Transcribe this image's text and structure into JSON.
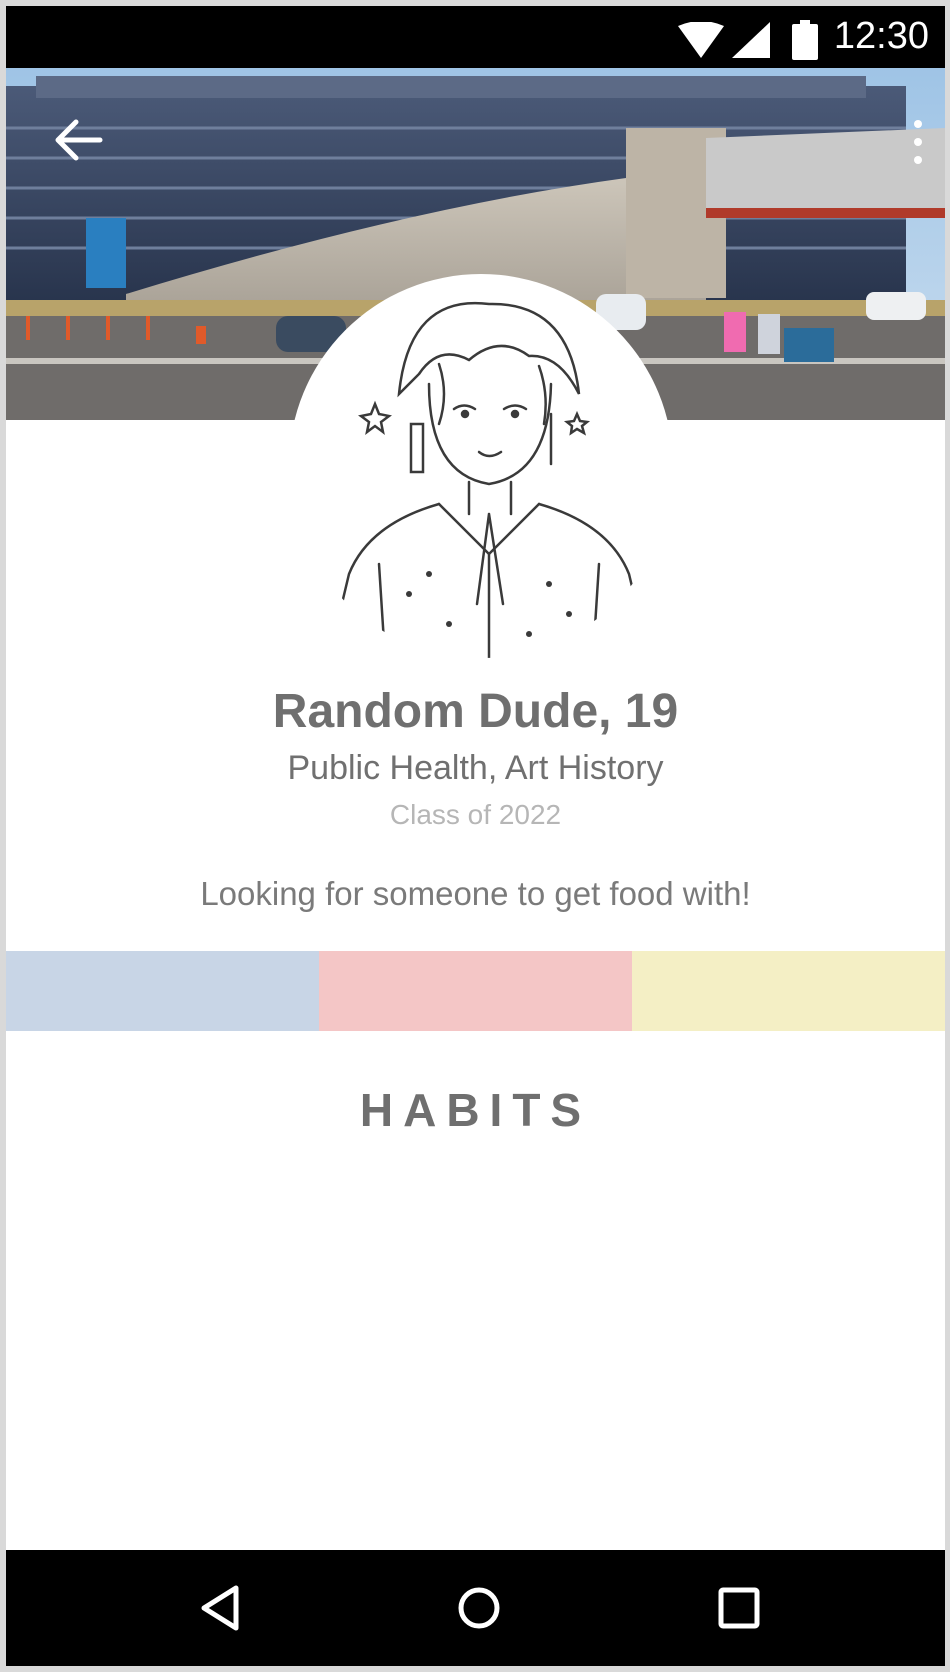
{
  "status_bar": {
    "time": "12:30",
    "icons": [
      "wifi-icon",
      "signal-icon",
      "battery-icon"
    ]
  },
  "header": {
    "back_icon": "arrow-left-icon",
    "menu_icon": "more-vertical-icon"
  },
  "profile": {
    "name_age": "Random Dude, 19",
    "majors": "Public Health, Art History",
    "class_year": "Class of 2022",
    "bio": "Looking for someone to get food with!"
  },
  "color_strip": {
    "colors": [
      "#c8d5e6",
      "#f4c6c6",
      "#f4efc5"
    ]
  },
  "habits": {
    "heading": "HABITS"
  },
  "nav_bar": {
    "icons": [
      "nav-back-icon",
      "nav-home-icon",
      "nav-recents-icon"
    ]
  }
}
